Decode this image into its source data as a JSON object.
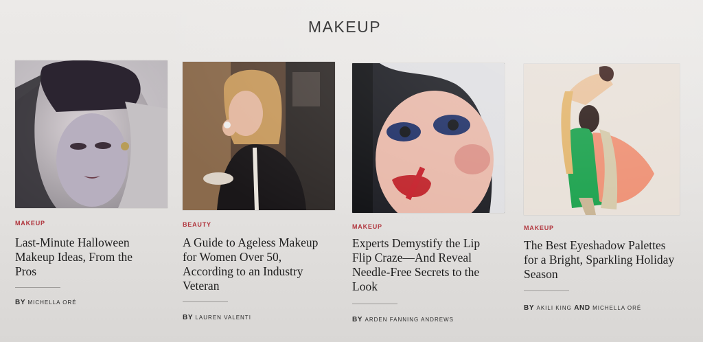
{
  "section": {
    "title": "MAKEUP"
  },
  "articles": [
    {
      "category": "MAKEUP",
      "headline": "Last-Minute Halloween Makeup Ideas, From the Pros",
      "byline_prefix": "BY",
      "author": "MICHELLA ORÉ",
      "image": "halloween-makeup-portrait"
    },
    {
      "category": "BEAUTY",
      "headline": "A Guide to Ageless Makeup for Women Over 50, According to an Industry Veteran",
      "byline_prefix": "BY",
      "author": "LAUREN VALENTI",
      "image": "woman-applying-makeup"
    },
    {
      "category": "MAKEUP",
      "headline": "Experts Demystify the Lip Flip Craze—And Reveal Needle-Free Secrets to the Look",
      "byline_prefix": "BY",
      "author": "ARDEN FANNING ANDREWS",
      "image": "blue-eyeshadow-red-lips-portrait"
    },
    {
      "category": "MAKEUP",
      "headline": "The Best Eyeshadow Palettes for a Bright, Sparkling Holiday Season",
      "byline_prefix": "BY",
      "author_1": "AKILI KING",
      "conjunction": "AND",
      "author_2": "MICHELLA ORÉ",
      "image": "model-in-colorful-fabric"
    }
  ],
  "colors": {
    "kicker": "#b0343c",
    "text": "#1d1d1d",
    "background": "#e8e6e4"
  }
}
